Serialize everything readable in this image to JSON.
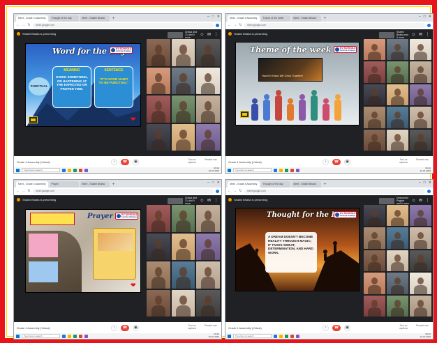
{
  "screens": [
    {
      "presenting": "Shalini Bhatia is presenting",
      "you_label": "Chaya and 21 and 9 more",
      "meet_title": "Grade 4 Assembly (Virtual)",
      "address": "meet.google.com",
      "tabs": [
        "Meet - Grade 4 Assembly",
        "Thought of the day",
        "Meet - Shalini Bhatia"
      ],
      "slide": {
        "heading": "Word for the Day",
        "word": "PUNCTUAL",
        "meaning_title": "MEANING",
        "meaning_text": "DOING SOMETHING, OR HAPPENING AT THE EXPECTED OR PROPER TIME.",
        "sentence_title": "SENTENCE",
        "sentence_text": "\"IT'S GOOD HABIT TO BE PUNCTUAL\""
      },
      "participants": 12
    },
    {
      "presenting": "Shalini Bhatia is presenting",
      "you_label": "Shalini Bhatia and 9 more",
      "meet_title": "Grade 4 Assembly (Virtual)",
      "address": "meet.google.com",
      "tabs": [
        "Meet - Grade 4 Assembly",
        "Theme of the week",
        "Meet - Shalini Bhatia"
      ],
      "slide": {
        "heading": "Theme of the week",
        "caption": "Hand in Hand We Grow Together"
      },
      "participants": 15
    },
    {
      "presenting": "Shalini Bhatia is presenting",
      "you_label": "Chaya and 21 and 9 more",
      "meet_title": "Grade 4 Assembly (Virtual)",
      "address": "meet.google.com",
      "tabs": [
        "Meet - Grade 4 Assembly",
        "Prayer",
        "Meet - Shalini Bhatia"
      ],
      "slide": {
        "heading": "Prayer"
      },
      "participants": 12
    },
    {
      "presenting": "Shalini Bhatia is presenting",
      "you_label": "Deepanshi Pagare and 9 more",
      "meet_title": "Grade 4 Assembly (Virtual)",
      "address": "meet.google.com",
      "tabs": [
        "Meet - Grade 4 Assembly",
        "Thought of the day",
        "Meet - Shalini Bhatia"
      ],
      "slide": {
        "heading": "Thought for the Day",
        "quote": "A DREAM DOESN'T BECOME REALITY THROUGH MAGIC; IT TAKES SWEAT, DETERMINATION, AND HARD WORK."
      },
      "participants": 15
    }
  ],
  "logo": {
    "name": "KV SCHOOLS",
    "sub": "Kendriya Vidyalaya"
  },
  "callbar": {
    "captions": "Turn on captions",
    "present": "Present now"
  },
  "taskbar": {
    "search": "Type here to search",
    "time": "09:32",
    "date": "24-07-2020"
  },
  "colors": {
    "border": "#e8141b",
    "accent": "#ffd400",
    "meet_bg": "#202124"
  }
}
